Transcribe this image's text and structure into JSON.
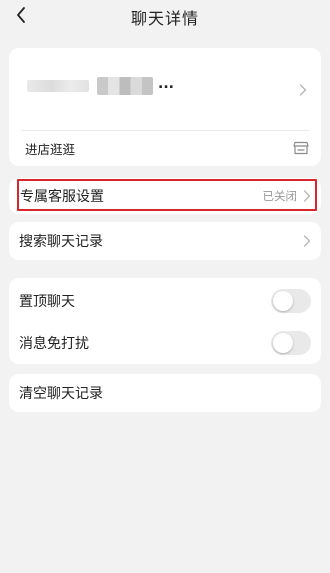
{
  "header": {
    "title": "聊天详情",
    "back_icon": "chevron-left-icon"
  },
  "store": {
    "name_suffix": "...",
    "visit_label": "进店逛逛",
    "visit_icon": "shop-icon"
  },
  "customer_service": {
    "label": "专属客服设置",
    "status": "已关闭",
    "highlight_color": "#d9262c"
  },
  "search": {
    "label": "搜索聊天记录"
  },
  "settings": {
    "pin_label": "置顶聊天",
    "pin_on": false,
    "mute_label": "消息免打扰",
    "mute_on": false
  },
  "clear": {
    "label": "清空聊天记录"
  },
  "colors": {
    "background": "#f2f2f2",
    "card": "#ffffff",
    "muted_text": "#999999",
    "toggle_off": "#e9e9e9"
  }
}
